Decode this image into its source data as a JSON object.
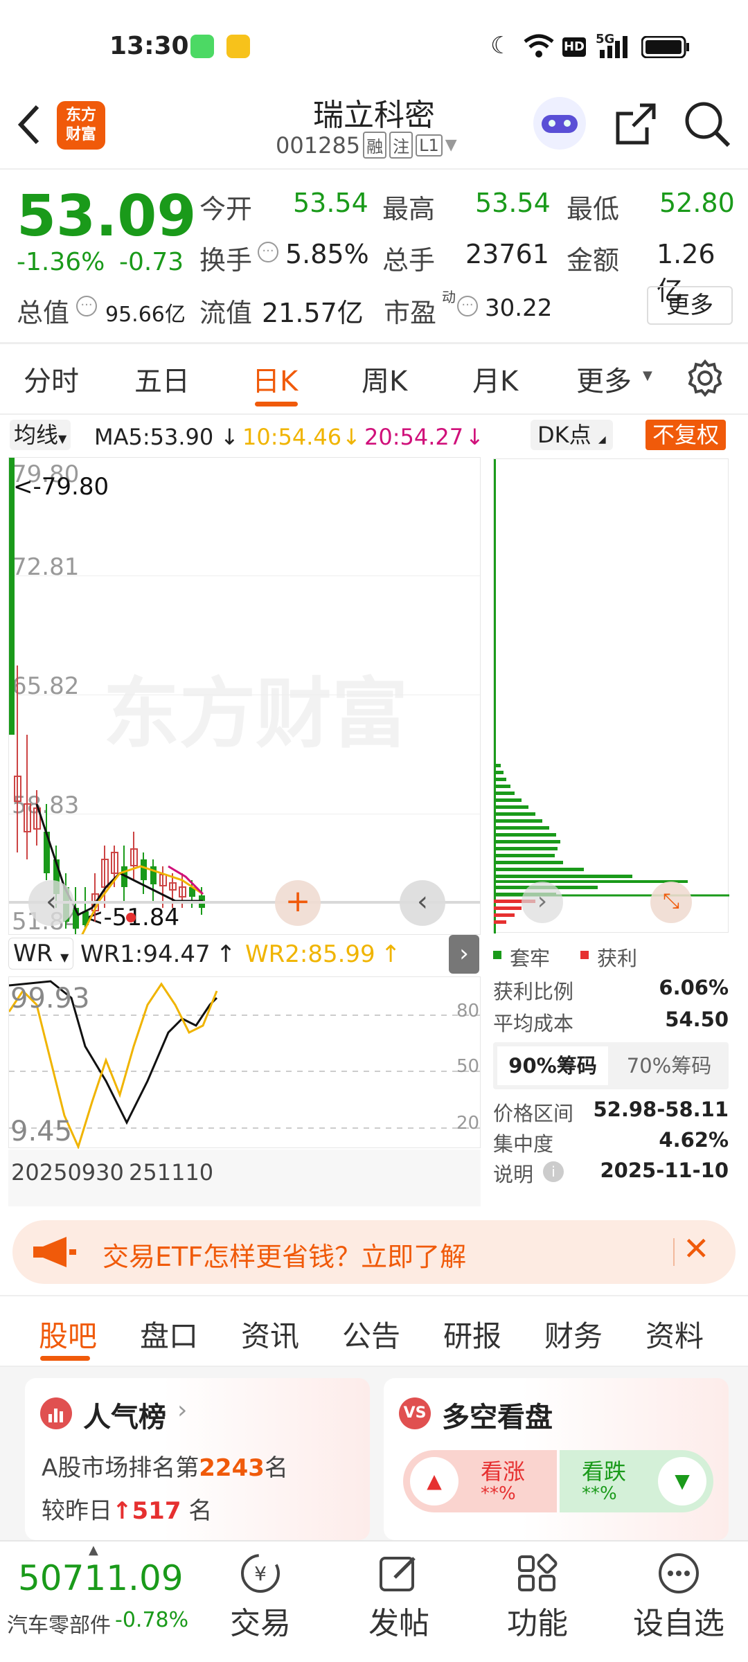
{
  "status_bar": {
    "time": "13:30",
    "network": "5G"
  },
  "header": {
    "title": "瑞立科密",
    "code": "001285",
    "tags": [
      "融",
      "注",
      "L1"
    ],
    "logo_text": "东方财富"
  },
  "quote": {
    "price": "53.09",
    "change_pct": "-1.36%",
    "change": "-0.73",
    "rows": [
      [
        {
          "label": "今开",
          "value": "53.54",
          "color": "down"
        },
        {
          "label": "最高",
          "value": "53.54",
          "color": "down"
        },
        {
          "label": "最低",
          "value": "52.80",
          "color": "down"
        }
      ],
      [
        {
          "label": "换手",
          "value": "5.85%",
          "color": "normal"
        },
        {
          "label": "总手",
          "value": "23761",
          "color": "normal"
        },
        {
          "label": "金额",
          "value": "1.26亿",
          "color": "normal"
        }
      ]
    ],
    "total_value_label": "总值",
    "total_value": "95.66亿",
    "float_label": "流值",
    "float_value": "21.57亿",
    "pe_label": "市盈",
    "pe_sup": "动",
    "pe_value": "30.22",
    "more": "更多"
  },
  "period_tabs": [
    "分时",
    "五日",
    "日K",
    "周K",
    "月K",
    "更多"
  ],
  "active_period": "日K",
  "indicator_bar": {
    "ma_btn": "均线",
    "ma5": "MA5:53.90",
    "ma10": "10:54.46",
    "ma20": "20:54.27",
    "dk": "DK点",
    "fq": "不复权"
  },
  "kline": {
    "labels": [
      "79.80",
      "72.81",
      "65.82",
      "58.83",
      "51.84"
    ],
    "max_label": "<-79.80",
    "min_label": "<-51.84",
    "watermark": "东方财富"
  },
  "wr": {
    "btn": "WR",
    "wr1": "WR1:94.47",
    "wr2": "WR2:85.99",
    "y_high": "99.93",
    "y_low": "9.45",
    "ticks": [
      "80",
      "50",
      "20"
    ],
    "date_start": "20250930",
    "date_end": "251110"
  },
  "chips": {
    "legend_trap": "套牢",
    "legend_profit": "获利",
    "rows": [
      {
        "label": "获利比例",
        "value": "6.06%"
      },
      {
        "label": "平均成本",
        "value": "54.50"
      }
    ],
    "tabs": [
      "90%筹码",
      "70%筹码"
    ],
    "rows2": [
      {
        "label": "价格区间",
        "value": "52.98-58.11"
      },
      {
        "label": "集中度",
        "value": "4.62%"
      },
      {
        "label": "说明",
        "value": "2025-11-10"
      }
    ]
  },
  "ad": {
    "text": "交易ETF怎样更省钱？立即了解"
  },
  "info_tabs": [
    "股吧",
    "盘口",
    "资讯",
    "公告",
    "研报",
    "财务",
    "资料"
  ],
  "popularity": {
    "title": "人气榜",
    "line1_pre": "A股市场排名第",
    "rank": "2243",
    "line1_post": "名",
    "line2_pre": "较昨日",
    "delta": "517",
    "line2_post": "名"
  },
  "bullbear": {
    "title": "多空看盘",
    "up_label": "看涨",
    "up_pct": "**%",
    "down_label": "看跌",
    "down_pct": "**%"
  },
  "bottom": {
    "index_value": "50711.09",
    "sector": "汽车零部件",
    "sector_change": "-0.78%",
    "nav": [
      "交易",
      "发帖",
      "功能",
      "设自选"
    ]
  },
  "colors": {
    "up": "#e63030",
    "down": "#1a9a1a",
    "accent": "#f05a0a",
    "ma10": "#f0b400",
    "ma20": "#d0107a"
  }
}
